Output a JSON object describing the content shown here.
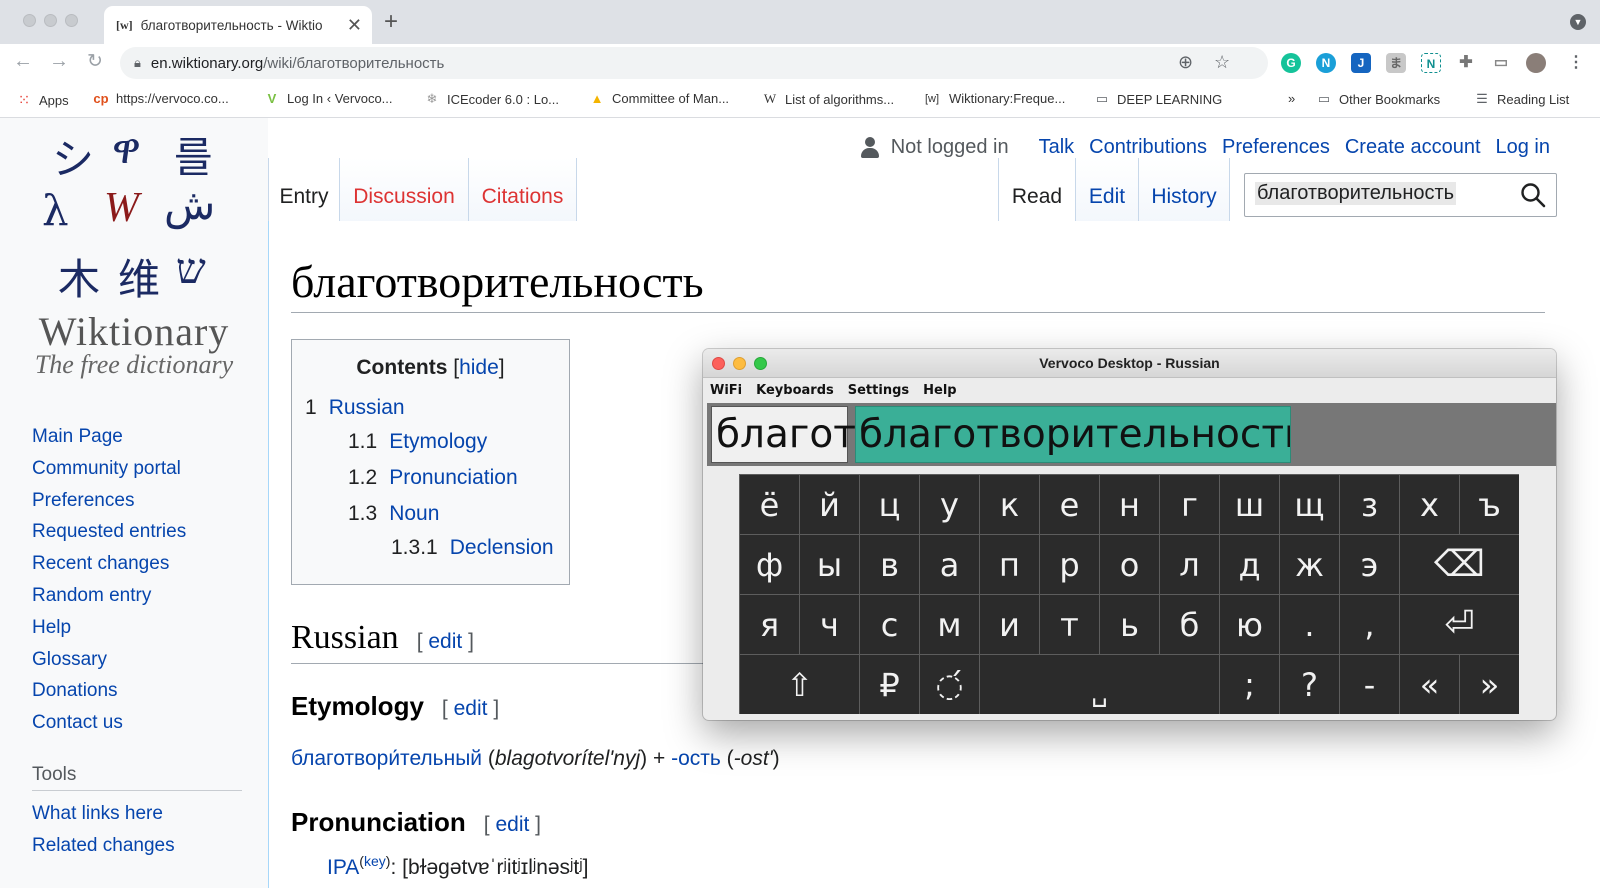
{
  "browser": {
    "tab_favicon": "[w]",
    "tab_title": "благотворительность - Wiktio",
    "url_host": "en.wiktionary.org",
    "url_path": "/wiki/благотворительность",
    "bookmarks": [
      {
        "label": "Apps",
        "icon": "apps-grid-icon"
      },
      {
        "label": "https://vervoco.co...",
        "icon": "vervoco-icon"
      },
      {
        "label": "Log In ‹ Vervoco...",
        "icon": "vervoco-v-icon"
      },
      {
        "label": "ICEcoder 6.0 : Lo...",
        "icon": "snowflake-icon"
      },
      {
        "label": "Committee of Man...",
        "icon": "google-drive-icon"
      },
      {
        "label": "List of algorithms...",
        "icon": "wikipedia-icon"
      },
      {
        "label": "Wiktionary:Freque...",
        "icon": "wiktionary-icon"
      },
      {
        "label": "DEEP LEARNING",
        "icon": "folder-icon"
      }
    ],
    "overflow": "»",
    "other_bookmarks": "Other Bookmarks",
    "reading_list": "Reading List"
  },
  "logo": {
    "glyphs": [
      "シ",
      "ዋ",
      "를",
      "λ",
      "W",
      "ش",
      "木",
      "维",
      "ש"
    ],
    "title": "Wiktionary",
    "tagline": "The free dictionary"
  },
  "sidebar": {
    "main": [
      "Main Page",
      "Community portal",
      "Preferences",
      "Requested entries",
      "Recent changes",
      "Random entry",
      "Help",
      "Glossary",
      "Donations",
      "Contact us"
    ],
    "tools_heading": "Tools",
    "tools": [
      "What links here",
      "Related changes"
    ]
  },
  "personal": {
    "not_logged_in": "Not logged in",
    "links": [
      "Talk",
      "Contributions",
      "Preferences",
      "Create account",
      "Log in"
    ]
  },
  "page_tabs": {
    "entry": "Entry",
    "discussion": "Discussion",
    "citations": "Citations",
    "read": "Read",
    "edit": "Edit",
    "history": "History"
  },
  "search": {
    "value": "благотворительность"
  },
  "article": {
    "title": "благотворительность",
    "toc": {
      "title": "Contents",
      "hide": "hide",
      "items": [
        {
          "num": "1",
          "text": "Russian"
        },
        {
          "num": "1.1",
          "text": "Etymology"
        },
        {
          "num": "1.2",
          "text": "Pronunciation"
        },
        {
          "num": "1.3",
          "text": "Noun"
        },
        {
          "num": "1.3.1",
          "text": "Declension"
        }
      ]
    },
    "h_russian": "Russian",
    "h_etymology": "Etymology",
    "h_pronunciation": "Pronunciation",
    "edit": "edit",
    "bracket_open": "[",
    "bracket_close": "]",
    "etym": {
      "word1": "благотвори́тельный",
      "translit1": "blagotvorítelʹnyj",
      "plus": "+",
      "word2": "-ость",
      "translit2": "-ostʹ"
    },
    "ipa": {
      "label": "IPA",
      "key": "key",
      "value": "[bɫəɡətvɐˈrʲitʲɪlʲnəsʲtʲ]"
    }
  },
  "vervoco": {
    "title": "Vervoco Desktop - Russian",
    "menu": [
      "WiFi",
      "Keyboards",
      "Settings",
      "Help"
    ],
    "typed": "благот",
    "suggestion": "благотворительность",
    "suggestion_color": "#3aaf97",
    "rows": [
      [
        "ё",
        "й",
        "ц",
        "у",
        "к",
        "е",
        "н",
        "г",
        "ш",
        "щ",
        "з",
        "х",
        "ъ"
      ],
      [
        "ф",
        "ы",
        "в",
        "а",
        "п",
        "р",
        "о",
        "л",
        "д",
        "ж",
        "э",
        "⌫"
      ],
      [
        "я",
        "ч",
        "с",
        "м",
        "и",
        "т",
        "ь",
        "б",
        "ю",
        ".",
        ",",
        "⏎"
      ],
      [
        "⇧",
        "₽",
        "◌́",
        "␣",
        ";",
        "?",
        "-",
        "«",
        "»"
      ]
    ]
  }
}
